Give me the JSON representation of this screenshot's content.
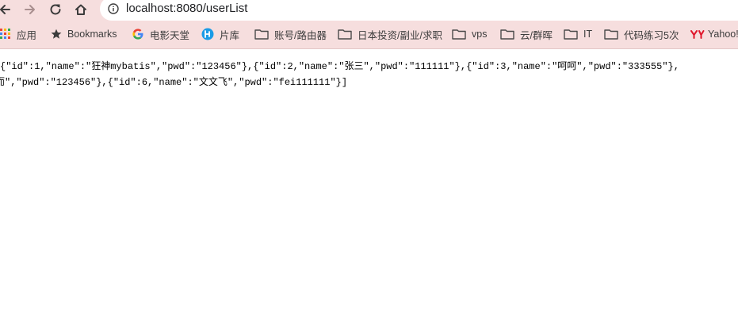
{
  "browser": {
    "url": "localhost:8080/userList",
    "bookmarks": [
      {
        "label": "应用",
        "icon": "apps-grid-icon"
      },
      {
        "label": "Bookmarks",
        "icon": "star-icon"
      },
      {
        "label": "电影天堂",
        "icon": "google-icon"
      },
      {
        "label": "片库",
        "icon": "pianku-logo-icon"
      },
      {
        "label": "账号/路由器",
        "icon": "folder-icon"
      },
      {
        "label": "日本投资/副业/求职",
        "icon": "folder-icon"
      },
      {
        "label": "vps",
        "icon": "folder-icon"
      },
      {
        "label": "云/群晖",
        "icon": "folder-icon"
      },
      {
        "label": "IT",
        "icon": "folder-icon"
      },
      {
        "label": "代码练习5次",
        "icon": "folder-icon"
      },
      {
        "label": "Yahoo!",
        "icon": "yahoo-logo-icon"
      }
    ]
  },
  "content": {
    "line1": "{\"id\":1,\"name\":\"狂神mybatis\",\"pwd\":\"123456\"},{\"id\":2,\"name\":\"张三\",\"pwd\":\"111111\"},{\"id\":3,\"name\":\"呵呵\",\"pwd\":\"333555\"},",
    "line2": "而\",\"pwd\":\"123456\"},{\"id\":6,\"name\":\"文文飞\",\"pwd\":\"fei111111\"}]"
  },
  "colors": {
    "chrome_bg": "#f6dede",
    "text": "#000000"
  }
}
